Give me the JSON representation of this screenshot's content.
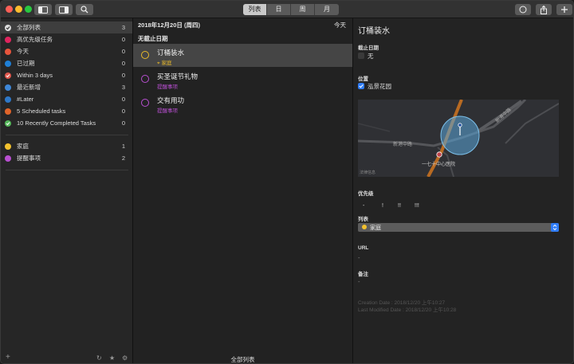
{
  "toolbar": {
    "segments": [
      "列表",
      "日",
      "周",
      "月"
    ],
    "active_segment": 0
  },
  "sidebar": {
    "items": [
      {
        "label": "全部列表",
        "count": "3",
        "color": "#ffffff"
      },
      {
        "label": "高优先级任务",
        "count": "0",
        "color": "#e0245e"
      },
      {
        "label": "今天",
        "count": "0",
        "color": "#e8553c"
      },
      {
        "label": "已过期",
        "count": "0",
        "color": "#1f7fd6"
      },
      {
        "label": "Within 3 days",
        "count": "0",
        "color": "#e0584e"
      },
      {
        "label": "最近新增",
        "count": "3",
        "color": "#3e87d8"
      },
      {
        "label": "#Later",
        "count": "0",
        "color": "#2e78c8"
      },
      {
        "label": "5 Scheduled tasks",
        "count": "0",
        "color": "#e0642a"
      },
      {
        "label": "10 Recently Completed Tasks",
        "count": "0",
        "color": "#55b85a"
      }
    ],
    "lists": [
      {
        "label": "家庭",
        "count": "1",
        "color": "#f2c12e"
      },
      {
        "label": "提醒事项",
        "count": "2",
        "color": "#b84fd1"
      }
    ],
    "bottom": {
      "add": "+",
      "refresh": "↻",
      "star": "★",
      "gear": "⚙"
    }
  },
  "middle": {
    "date_header": "2018年12月20日 (周四)",
    "today": "今天",
    "section": "无截止日期",
    "tasks": [
      {
        "title": "订桶装水",
        "list": "家庭",
        "circle": "#e8b92a",
        "sub_color": "#e8b92a"
      },
      {
        "title": "买圣诞节礼物",
        "list": "提醒事项",
        "circle": "#b84fd1",
        "sub_color": "#b84fd1"
      },
      {
        "title": "交有用功",
        "list": "提醒事项",
        "circle": "#b84fd1",
        "sub_color": "#b84fd1"
      }
    ],
    "footer": "全部列表"
  },
  "detail": {
    "title": "订桶装水",
    "due_label": "截止日期",
    "due_value": "无",
    "location_label": "位置",
    "location_value": "泓景花园",
    "map": {
      "road_1": "新港中路",
      "road_2": "新港中路",
      "poi": "一七十中心医院",
      "legal": "法律信息"
    },
    "priority_label": "优先级",
    "priority_options": [
      "-",
      "!",
      "!!",
      "!!!"
    ],
    "list_label": "列表",
    "list_value": "家庭",
    "url_label": "URL",
    "url_value": "-",
    "notes_label": "备注",
    "notes_value": "-",
    "creation": "Creation Date : 2018/12/20 上午10:27",
    "modified": "Last Modified Date : 2018/12/20 上午10:28"
  }
}
